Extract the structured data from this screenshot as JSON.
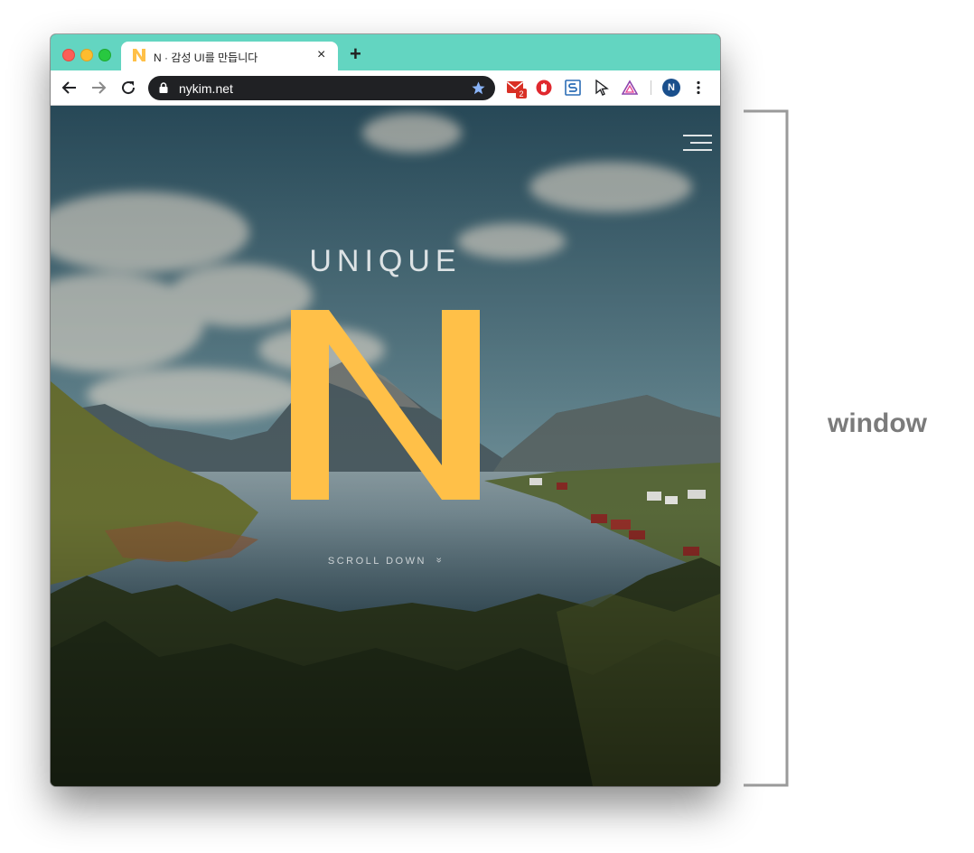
{
  "browser": {
    "tab": {
      "title": "N · 감성 UI를 만듭니다",
      "favicon_letter": "N",
      "close_icon": "×"
    },
    "new_tab_icon": "+",
    "address_bar": {
      "url": "nykim.net"
    },
    "extensions": {
      "gmail_badge": "2"
    },
    "profile": {
      "avatar_letter": "N"
    }
  },
  "hero": {
    "heading": "UNIQUE",
    "logo_letter": "N",
    "scroll_label": "SCROLL DOWN",
    "scroll_icon": "»",
    "logo_color": "#ffc048"
  },
  "annotation": {
    "label": "window"
  },
  "colors": {
    "tabbar": "#63d5c1",
    "omnibox": "#202124"
  }
}
